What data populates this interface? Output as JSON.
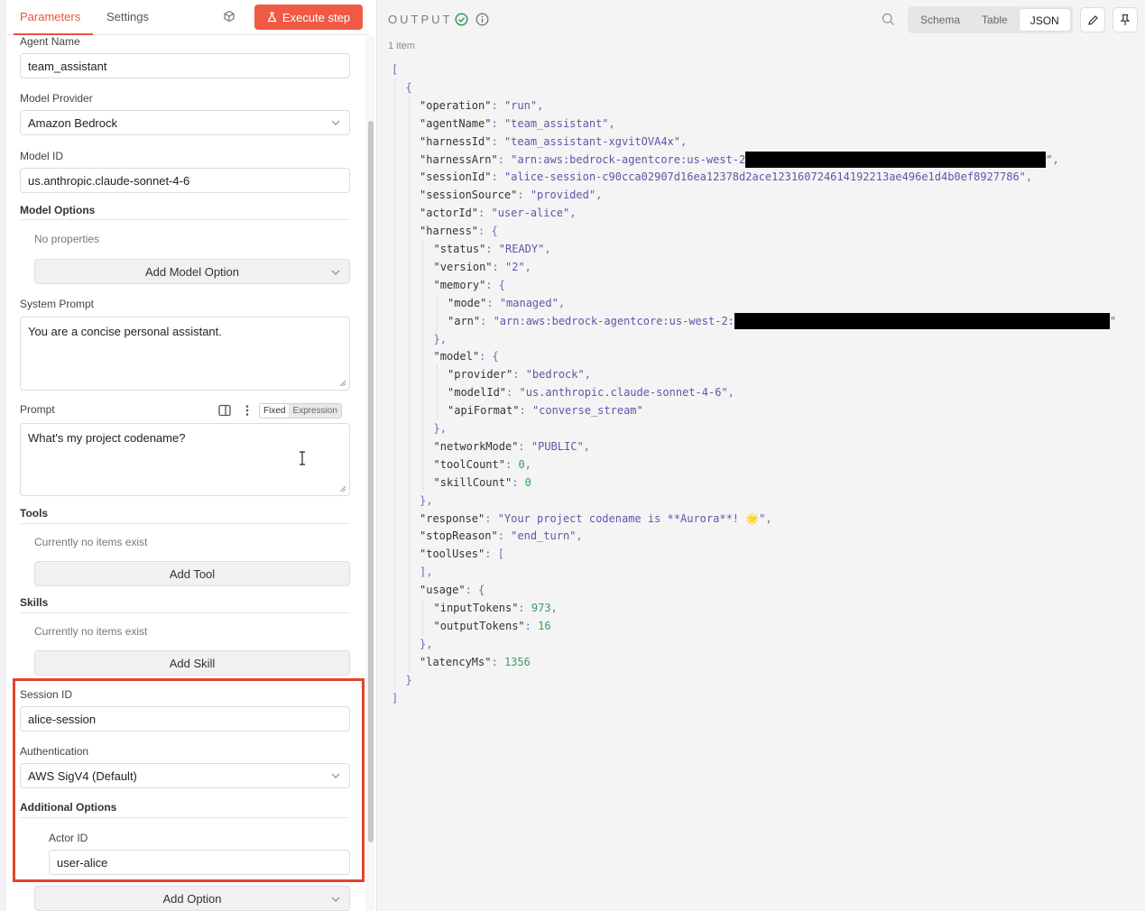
{
  "tabs": {
    "parameters": "Parameters",
    "settings": "Settings"
  },
  "execute_button": "Execute step",
  "fields": {
    "agent_name": {
      "label": "Agent Name",
      "value": "team_assistant"
    },
    "model_provider": {
      "label": "Model Provider",
      "value": "Amazon Bedrock"
    },
    "model_id": {
      "label": "Model ID",
      "value": "us.anthropic.claude-sonnet-4-6"
    },
    "model_options": {
      "label": "Model Options",
      "empty": "No properties",
      "button": "Add Model Option"
    },
    "system_prompt": {
      "label": "System Prompt",
      "value": "You are a concise personal assistant."
    },
    "prompt": {
      "label": "Prompt",
      "value": "What's my project codename?",
      "mode_fixed": "Fixed",
      "mode_expression": "Expression"
    },
    "tools": {
      "label": "Tools",
      "empty": "Currently no items exist",
      "button": "Add Tool"
    },
    "skills": {
      "label": "Skills",
      "empty": "Currently no items exist",
      "button": "Add Skill"
    },
    "session_id": {
      "label": "Session ID",
      "value": "alice-session"
    },
    "authentication": {
      "label": "Authentication",
      "value": "AWS SigV4 (Default)"
    },
    "additional_options": {
      "label": "Additional Options"
    },
    "actor_id": {
      "label": "Actor ID",
      "value": "user-alice"
    },
    "add_option": "Add Option"
  },
  "output": {
    "title": "OUTPUT",
    "item_count": "1 item",
    "views": [
      "Schema",
      "Table",
      "JSON"
    ],
    "active_view": "JSON",
    "colors": {
      "string": "#5b58a7",
      "number": "#3d9a5c",
      "accent": "#ef5a45",
      "highlight": "#e2442f"
    },
    "json_lines": [
      {
        "i": 0,
        "t": [
          [
            "p",
            "["
          ]
        ]
      },
      {
        "i": 1,
        "t": [
          [
            "p",
            "{"
          ]
        ]
      },
      {
        "i": 2,
        "t": [
          [
            "k",
            "\"operation\""
          ],
          [
            "p",
            ": "
          ],
          [
            "s",
            "\"run\""
          ],
          [
            "p",
            ","
          ]
        ]
      },
      {
        "i": 2,
        "t": [
          [
            "k",
            "\"agentName\""
          ],
          [
            "p",
            ": "
          ],
          [
            "s",
            "\"team_assistant\""
          ],
          [
            "p",
            ","
          ]
        ]
      },
      {
        "i": 2,
        "t": [
          [
            "k",
            "\"harnessId\""
          ],
          [
            "p",
            ": "
          ],
          [
            "s",
            "\"team_assistant-xgvitOVA4x\""
          ],
          [
            "p",
            ","
          ]
        ]
      },
      {
        "i": 2,
        "t": [
          [
            "k",
            "\"harnessArn\""
          ],
          [
            "p",
            ": "
          ],
          [
            "s",
            "\"arn:aws:bedrock-agentcore:us-west-2"
          ],
          [
            "r",
            "r1"
          ],
          [
            "s",
            "\""
          ],
          [
            "p",
            ","
          ]
        ]
      },
      {
        "i": 2,
        "t": [
          [
            "k",
            "\"sessionId\""
          ],
          [
            "p",
            ": "
          ],
          [
            "s",
            "\"alice-session-c90cca02907d16ea12378d2ace123160724614192213ae496e1d4b0ef8927786\""
          ],
          [
            "p",
            ","
          ]
        ]
      },
      {
        "i": 2,
        "t": [
          [
            "k",
            "\"sessionSource\""
          ],
          [
            "p",
            ": "
          ],
          [
            "s",
            "\"provided\""
          ],
          [
            "p",
            ","
          ]
        ]
      },
      {
        "i": 2,
        "t": [
          [
            "k",
            "\"actorId\""
          ],
          [
            "p",
            ": "
          ],
          [
            "s",
            "\"user-alice\""
          ],
          [
            "p",
            ","
          ]
        ]
      },
      {
        "i": 2,
        "t": [
          [
            "k",
            "\"harness\""
          ],
          [
            "p",
            ": {"
          ]
        ]
      },
      {
        "i": 3,
        "t": [
          [
            "k",
            "\"status\""
          ],
          [
            "p",
            ": "
          ],
          [
            "s",
            "\"READY\""
          ],
          [
            "p",
            ","
          ]
        ]
      },
      {
        "i": 3,
        "t": [
          [
            "k",
            "\"version\""
          ],
          [
            "p",
            ": "
          ],
          [
            "s",
            "\"2\""
          ],
          [
            "p",
            ","
          ]
        ]
      },
      {
        "i": 3,
        "t": [
          [
            "k",
            "\"memory\""
          ],
          [
            "p",
            ": {"
          ]
        ]
      },
      {
        "i": 4,
        "t": [
          [
            "k",
            "\"mode\""
          ],
          [
            "p",
            ": "
          ],
          [
            "s",
            "\"managed\""
          ],
          [
            "p",
            ","
          ]
        ]
      },
      {
        "i": 4,
        "t": [
          [
            "k",
            "\"arn\""
          ],
          [
            "p",
            ": "
          ],
          [
            "s",
            "\"arn:aws:bedrock-agentcore:us-west-2:"
          ],
          [
            "r",
            "r2"
          ],
          [
            "s",
            "\""
          ]
        ]
      },
      {
        "i": 3,
        "t": [
          [
            "p",
            "},"
          ]
        ]
      },
      {
        "i": 3,
        "t": [
          [
            "k",
            "\"model\""
          ],
          [
            "p",
            ": {"
          ]
        ]
      },
      {
        "i": 4,
        "t": [
          [
            "k",
            "\"provider\""
          ],
          [
            "p",
            ": "
          ],
          [
            "s",
            "\"bedrock\""
          ],
          [
            "p",
            ","
          ]
        ]
      },
      {
        "i": 4,
        "t": [
          [
            "k",
            "\"modelId\""
          ],
          [
            "p",
            ": "
          ],
          [
            "s",
            "\"us.anthropic.claude-sonnet-4-6\""
          ],
          [
            "p",
            ","
          ]
        ]
      },
      {
        "i": 4,
        "t": [
          [
            "k",
            "\"apiFormat\""
          ],
          [
            "p",
            ": "
          ],
          [
            "s",
            "\"converse_stream\""
          ]
        ]
      },
      {
        "i": 3,
        "t": [
          [
            "p",
            "},"
          ]
        ]
      },
      {
        "i": 3,
        "t": [
          [
            "k",
            "\"networkMode\""
          ],
          [
            "p",
            ": "
          ],
          [
            "s",
            "\"PUBLIC\""
          ],
          [
            "p",
            ","
          ]
        ]
      },
      {
        "i": 3,
        "t": [
          [
            "k",
            "\"toolCount\""
          ],
          [
            "p",
            ": "
          ],
          [
            "n",
            "0"
          ],
          [
            "p",
            ","
          ]
        ]
      },
      {
        "i": 3,
        "t": [
          [
            "k",
            "\"skillCount\""
          ],
          [
            "p",
            ": "
          ],
          [
            "n",
            "0"
          ]
        ]
      },
      {
        "i": 2,
        "t": [
          [
            "p",
            "},"
          ]
        ]
      },
      {
        "i": 2,
        "t": [
          [
            "k",
            "\"response\""
          ],
          [
            "p",
            ": "
          ],
          [
            "s",
            "\"Your project codename is **Aurora**! 🌟\""
          ],
          [
            "p",
            ","
          ]
        ]
      },
      {
        "i": 2,
        "t": [
          [
            "k",
            "\"stopReason\""
          ],
          [
            "p",
            ": "
          ],
          [
            "s",
            "\"end_turn\""
          ],
          [
            "p",
            ","
          ]
        ]
      },
      {
        "i": 2,
        "t": [
          [
            "k",
            "\"toolUses\""
          ],
          [
            "p",
            ": ["
          ]
        ]
      },
      {
        "i": 2,
        "t": [
          [
            "p",
            "],"
          ]
        ]
      },
      {
        "i": 2,
        "t": [
          [
            "k",
            "\"usage\""
          ],
          [
            "p",
            ": {"
          ]
        ]
      },
      {
        "i": 3,
        "t": [
          [
            "k",
            "\"inputTokens\""
          ],
          [
            "p",
            ": "
          ],
          [
            "n",
            "973"
          ],
          [
            "p",
            ","
          ]
        ]
      },
      {
        "i": 3,
        "t": [
          [
            "k",
            "\"outputTokens\""
          ],
          [
            "p",
            ": "
          ],
          [
            "n",
            "16"
          ]
        ]
      },
      {
        "i": 2,
        "t": [
          [
            "p",
            "},"
          ]
        ]
      },
      {
        "i": 2,
        "t": [
          [
            "k",
            "\"latencyMs\""
          ],
          [
            "p",
            ": "
          ],
          [
            "n",
            "1356"
          ]
        ]
      },
      {
        "i": 1,
        "t": [
          [
            "p",
            "}"
          ]
        ]
      },
      {
        "i": 0,
        "t": [
          [
            "p",
            "]"
          ]
        ]
      }
    ]
  }
}
